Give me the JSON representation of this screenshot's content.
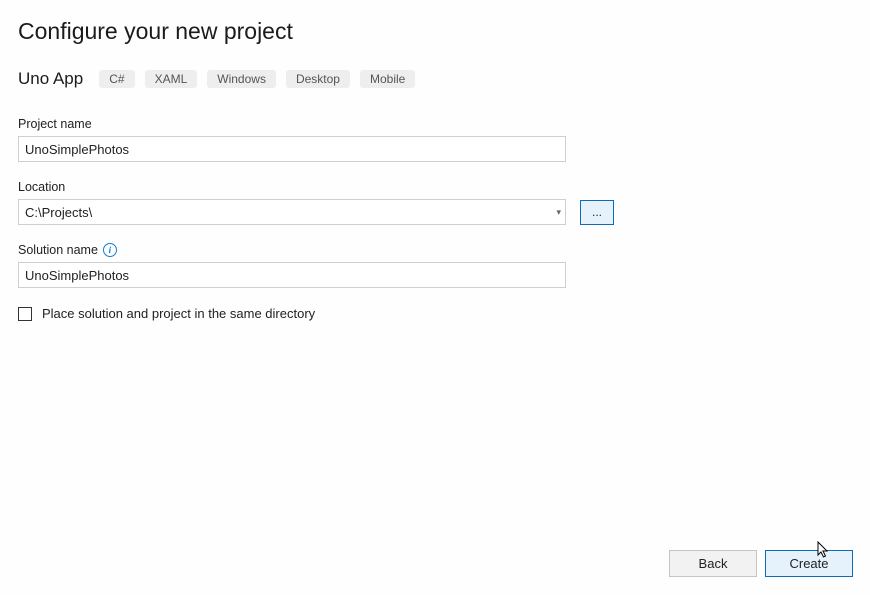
{
  "header": {
    "title": "Configure your new project",
    "template_name": "Uno App",
    "tags": [
      "C#",
      "XAML",
      "Windows",
      "Desktop",
      "Mobile"
    ]
  },
  "fields": {
    "project_name": {
      "label": "Project name",
      "value": "UnoSimplePhotos"
    },
    "location": {
      "label": "Location",
      "value": "C:\\Projects\\",
      "browse_label": "..."
    },
    "solution_name": {
      "label": "Solution name",
      "value": "UnoSimplePhotos"
    },
    "same_dir": {
      "label": "Place solution and project in the same directory",
      "checked": false
    }
  },
  "footer": {
    "back": "Back",
    "create": "Create"
  }
}
